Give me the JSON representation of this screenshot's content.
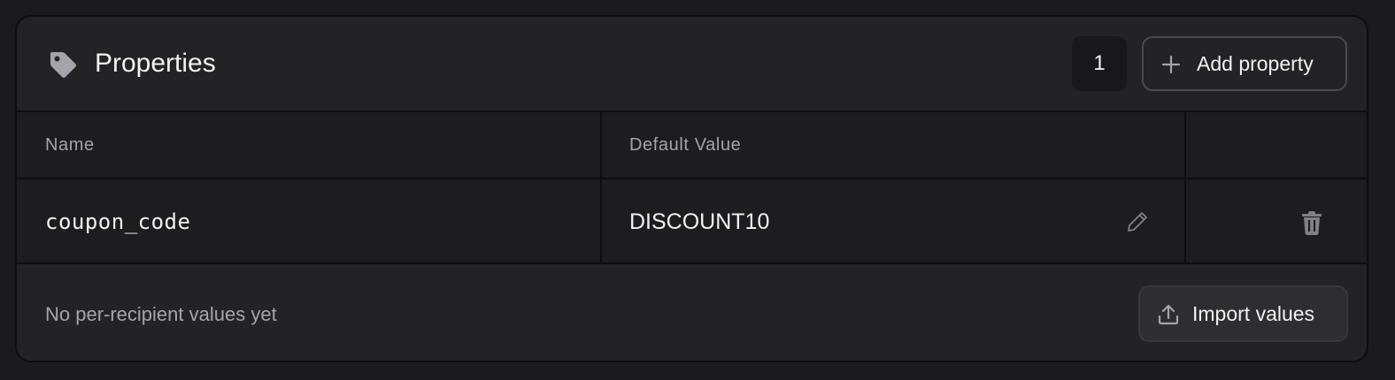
{
  "header": {
    "title": "Properties",
    "count": "1",
    "add_button_label": "Add property",
    "icon": "tag-icon"
  },
  "table": {
    "columns": [
      "Name",
      "Default Value",
      ""
    ],
    "rows": [
      {
        "name": "coupon_code",
        "default_value": "DISCOUNT10"
      }
    ]
  },
  "footer": {
    "empty_text": "No per-recipient values yet",
    "import_button_label": "Import values"
  },
  "colors": {
    "background": "#1b1b1d",
    "card": "#232326",
    "table": "#1d1d20",
    "text": "#f2f2f3",
    "muted": "#a4a4aa",
    "border": "#0e0e10"
  },
  "icons": [
    "tag-icon",
    "plus-icon",
    "pencil-icon",
    "trash-icon",
    "upload-icon"
  ]
}
